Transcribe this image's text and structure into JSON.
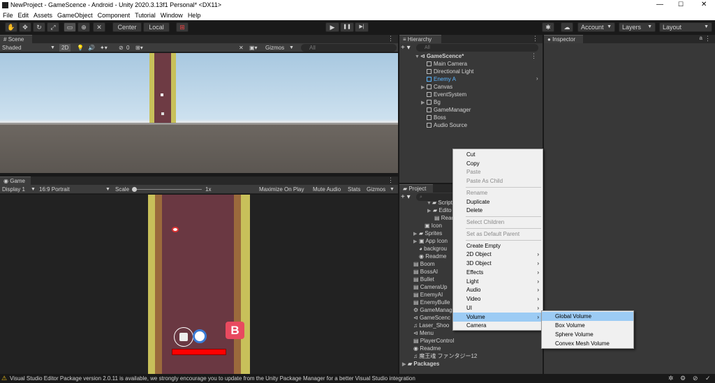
{
  "window": {
    "title": "NewProject - GameScence - Android - Unity 2020.3.13f1 Personal* <DX11>",
    "min": "—",
    "max": "☐",
    "close": "✕"
  },
  "menu": [
    "File",
    "Edit",
    "Assets",
    "GameObject",
    "Component",
    "Tutorial",
    "Window",
    "Help"
  ],
  "toolbar": {
    "center": "Center",
    "local": "Local",
    "account": "Account",
    "layers": "Layers",
    "layout": "Layout",
    "play": "▶",
    "pause": "❚❚",
    "step": "▶|"
  },
  "scene": {
    "tab": "Scene",
    "shading": "Shaded",
    "mode2d": "2D",
    "fx_count": "0",
    "gizmos": "Gizmos",
    "search_placeholder": "All"
  },
  "game": {
    "tab": "Game",
    "display": "Display 1",
    "aspect": "16:9 Portrait",
    "scale_label": "Scale",
    "scale_value": "1x",
    "maximize": "Maximize On Play",
    "mute": "Mute Audio",
    "stats": "Stats",
    "gizmos": "Gizmos",
    "boss_badge": "B"
  },
  "hierarchy": {
    "tab": "Hierarchy",
    "search_placeholder": "All",
    "scene_name": "GameScence*",
    "items": [
      "Main Camera",
      "Directional Light",
      "Enemy A",
      "Canvas",
      "EventSystem",
      "Bg",
      "GameManager",
      "Boss",
      "Audio Source"
    ]
  },
  "inspector": {
    "tab": "Inspector"
  },
  "project": {
    "tab": "Project",
    "items": [
      "Scripts",
      "Edito",
      "Read",
      "Icon",
      "Sprites",
      "App Icon",
      "backgrou",
      "Readme",
      "Boom",
      "BossAI",
      "Bullet",
      "CameraUp",
      "EnemyAI",
      "EnemyBulle",
      "GameManag",
      "GameScenc",
      "Laser_Shoo",
      "Menu",
      "PlayerControl",
      "Readme",
      "魔王魂  ファンタジー12",
      "Packages"
    ]
  },
  "context_menu": {
    "items": [
      {
        "label": "Cut",
        "disabled": false
      },
      {
        "label": "Copy",
        "disabled": false
      },
      {
        "label": "Paste",
        "disabled": true
      },
      {
        "label": "Paste As Child",
        "disabled": true
      },
      {
        "label": "Rename",
        "disabled": true
      },
      {
        "label": "Duplicate",
        "disabled": false
      },
      {
        "label": "Delete",
        "disabled": false
      },
      {
        "label": "Select Children",
        "disabled": true
      },
      {
        "label": "Set as Default Parent",
        "disabled": true
      },
      {
        "label": "Create Empty",
        "disabled": false
      },
      {
        "label": "2D Object",
        "disabled": false
      },
      {
        "label": "3D Object",
        "disabled": false
      },
      {
        "label": "Effects",
        "disabled": false
      },
      {
        "label": "Light",
        "disabled": false
      },
      {
        "label": "Audio",
        "disabled": false
      },
      {
        "label": "Video",
        "disabled": false
      },
      {
        "label": "UI",
        "disabled": false
      },
      {
        "label": "Volume",
        "disabled": false
      },
      {
        "label": "Camera",
        "disabled": false
      }
    ],
    "submenu": [
      "Global Volume",
      "Box Volume",
      "Sphere Volume",
      "Convex Mesh Volume"
    ]
  },
  "status": {
    "message": "Visual Studio Editor Package version 2.0.11 is available, we strongly encourage you to update from the Unity Package Manager for a better Visual Studio integration"
  },
  "colors": {
    "highlight": "#9ccbf4",
    "selected_text": "#5ab5ff",
    "warning": "#f5c518"
  }
}
